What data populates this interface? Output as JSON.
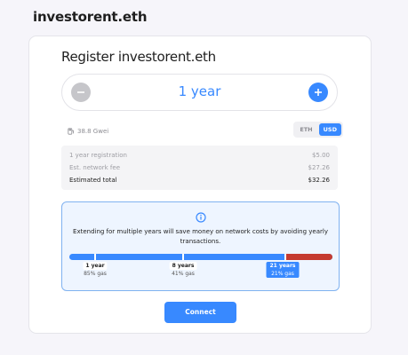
{
  "header": {
    "title": "investorent.eth"
  },
  "card": {
    "title": "Register investorent.eth",
    "duration": {
      "label": "1 year"
    },
    "gas": {
      "value": "38.8 Gwei"
    },
    "currency": {
      "options": [
        "ETH",
        "USD"
      ],
      "selected": "USD"
    },
    "fees": [
      {
        "label": "1 year registration",
        "value": "$5.00"
      },
      {
        "label": "Est. network fee",
        "value": "$27.26"
      },
      {
        "label": "Estimated total",
        "value": "$32.26"
      }
    ],
    "info": {
      "text": "Extending for multiple years will save money on network costs by avoiding yearly transactions.",
      "markers": [
        {
          "years": "1 year",
          "gas": "85% gas"
        },
        {
          "years": "8 years",
          "gas": "41% gas"
        },
        {
          "years": "21 years",
          "gas": "21% gas"
        }
      ]
    },
    "connect_label": "Connect"
  },
  "colors": {
    "accent": "#3889ff",
    "warning": "#c53b30"
  }
}
